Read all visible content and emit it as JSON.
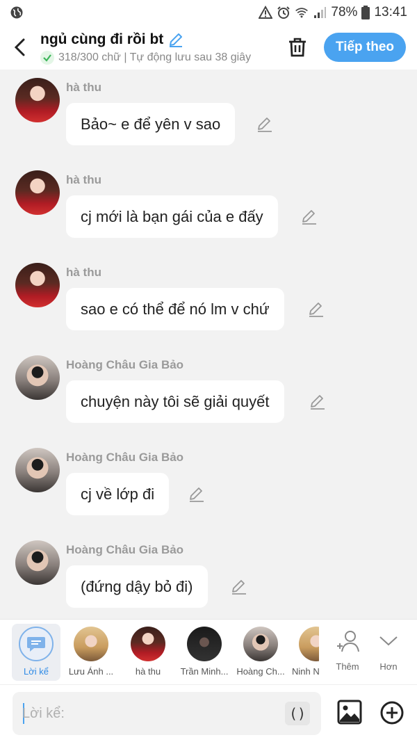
{
  "status_bar": {
    "battery": "78%",
    "time": "13:41"
  },
  "header": {
    "title": "ngủ cùng đi rồi bt",
    "subtitle": "318/300 chữ | Tự động lưu sau 38 giây",
    "next_label": "Tiếp theo"
  },
  "messages": [
    {
      "sender": "hà thu",
      "text": "Bảo~ e để yên v sao",
      "avatar": "girl"
    },
    {
      "sender": "hà thu",
      "text": "cj mới là bạn gái của e đấy",
      "avatar": "girl"
    },
    {
      "sender": "hà thu",
      "text": "sao e có thể để nó lm v chứ",
      "avatar": "girl"
    },
    {
      "sender": "Hoàng Châu Gia Bảo",
      "text": "chuyện này tôi sẽ giải quyết",
      "avatar": "boy"
    },
    {
      "sender": "Hoàng Châu Gia Bảo",
      "text": "cj về lớp đi",
      "avatar": "boy"
    },
    {
      "sender": "Hoàng Châu Gia Bảo",
      "text": "(đứng dậy bỏ đi)",
      "avatar": "boy"
    }
  ],
  "characters": [
    {
      "label": "Lời kể",
      "selected": true
    },
    {
      "label": "Lưu Ánh ..."
    },
    {
      "label": "hà thu"
    },
    {
      "label": "Trần Minh..."
    },
    {
      "label": "Hoàng Ch..."
    },
    {
      "label": "Ninh N"
    }
  ],
  "tools": {
    "add_label": "Thêm",
    "more_label": "Hơn"
  },
  "input": {
    "placeholder": "Lời kể:",
    "emoji_label": "()"
  }
}
